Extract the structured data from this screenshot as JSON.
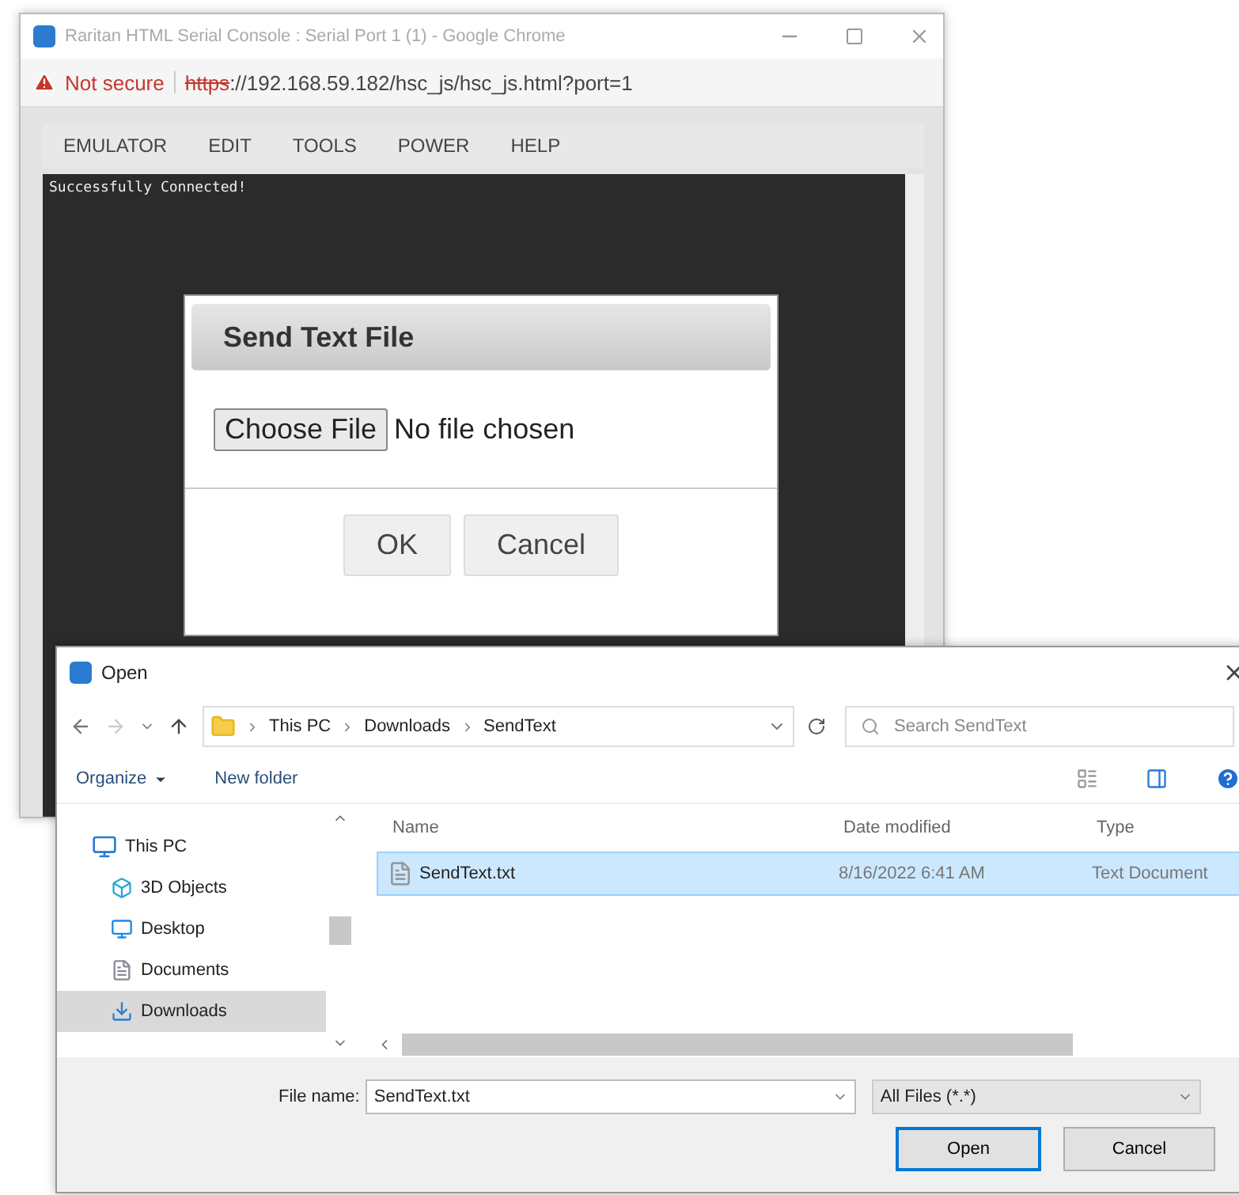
{
  "browser": {
    "title": "Raritan HTML Serial Console : Serial Port 1 (1) - Google Chrome",
    "security_warning": "Not secure",
    "url_scheme": "https",
    "url_rest": "://192.168.59.182/hsc_js/hsc_js.html?port=1",
    "menu": [
      "EMULATOR",
      "EDIT",
      "TOOLS",
      "POWER",
      "HELP"
    ],
    "terminal_output": "Successfully Connected!"
  },
  "modal": {
    "title": "Send Text File",
    "choose_button": "Choose File",
    "file_status": "No file chosen",
    "buttons": [
      "OK",
      "Cancel"
    ]
  },
  "open_dialog": {
    "title": "Open",
    "breadcrumb": [
      "This PC",
      "Downloads",
      "SendText"
    ],
    "search": {
      "placeholder": "Search SendText"
    },
    "toolbar": [
      {
        "label": "Organize",
        "has_menu": true
      },
      {
        "label": "New folder",
        "has_menu": false
      }
    ],
    "nav_items": [
      {
        "kind": "pc",
        "label": "This PC",
        "selected": false,
        "children": [
          {
            "kind": "objects",
            "label": "3D Objects",
            "selected": false
          },
          {
            "kind": "desktop",
            "label": "Desktop",
            "selected": false
          },
          {
            "kind": "documents",
            "label": "Documents",
            "selected": false
          },
          {
            "kind": "downloads",
            "label": "Downloads",
            "selected": true
          }
        ]
      }
    ],
    "columns": [
      "Name",
      "Date modified",
      "Type"
    ],
    "files": [
      {
        "name": "SendText.txt",
        "date": "8/16/2022 6:41 AM",
        "type": "Text Document",
        "selected": true
      }
    ],
    "file_name_label": "File name:",
    "file_name": "SendText.txt",
    "file_type": "All Files (*.*)",
    "buttons": [
      {
        "label": "Open",
        "default": true
      },
      {
        "label": "Cancel",
        "default": false
      }
    ]
  }
}
